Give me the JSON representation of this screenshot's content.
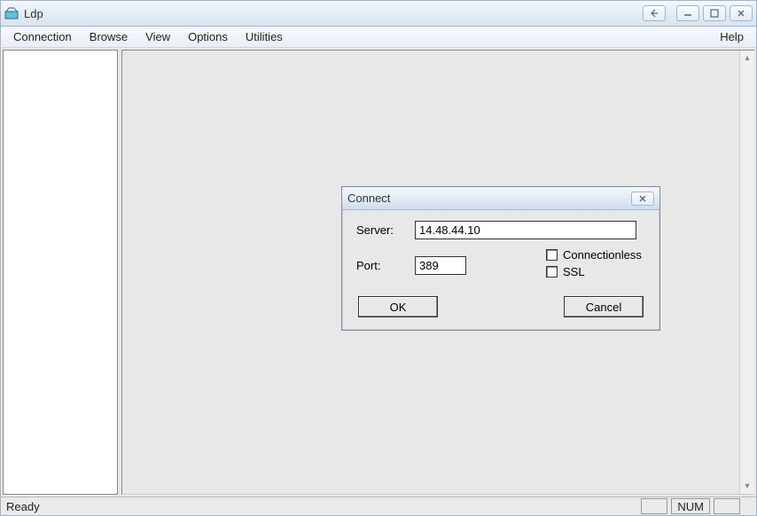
{
  "window": {
    "title": "Ldp"
  },
  "menu": {
    "items": [
      "Connection",
      "Browse",
      "View",
      "Options",
      "Utilities"
    ],
    "help": "Help"
  },
  "status": {
    "text": "Ready",
    "indicator": "NUM"
  },
  "dialog": {
    "title": "Connect",
    "server_label": "Server:",
    "server_value": "14.48.44.10",
    "port_label": "Port:",
    "port_value": "389",
    "connectionless_label": "Connectionless",
    "ssl_label": "SSL",
    "ok_label": "OK",
    "cancel_label": "Cancel"
  }
}
